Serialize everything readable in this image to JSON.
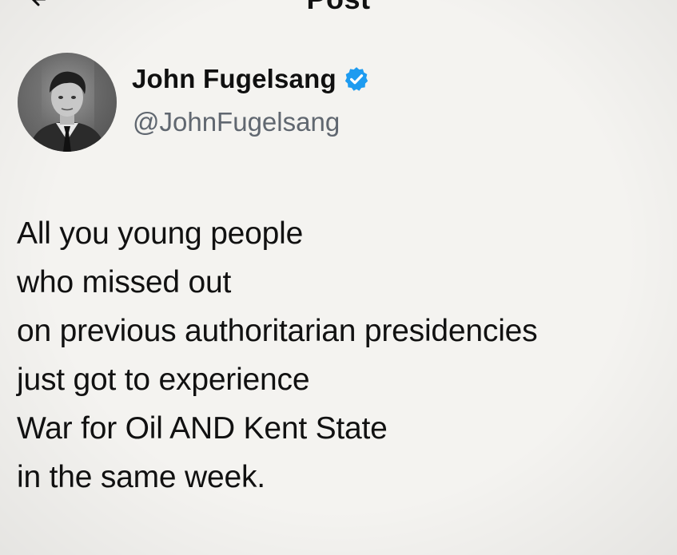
{
  "header": {
    "title": "Post"
  },
  "author": {
    "display_name": "John Fugelsang",
    "handle": "@JohnFugelsang",
    "verified": true,
    "verified_color": "#1d9bf0"
  },
  "post": {
    "lines": [
      "All you young people",
      "who missed out",
      "on previous authoritarian presidencies",
      "just got to experience",
      "War for Oil AND Kent State",
      "in the same week."
    ]
  },
  "icons": {
    "back": "arrow-left-icon",
    "verified": "verified-badge-icon",
    "avatar": "profile-photo"
  }
}
